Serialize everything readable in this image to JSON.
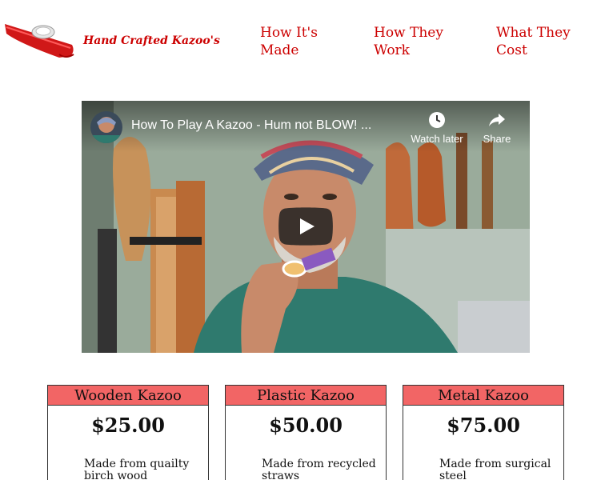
{
  "header": {
    "logo_text": "Hand Crafted Kazoo's",
    "nav": [
      {
        "label": "How It's Made"
      },
      {
        "label": "How They Work"
      },
      {
        "label": "What They Cost"
      }
    ]
  },
  "video": {
    "title": "How To Play A Kazoo - Hum not BLOW! ...",
    "watch_later_label": "Watch later",
    "share_label": "Share"
  },
  "pricing": [
    {
      "name": "Wooden Kazoo",
      "price": "$25.00",
      "description": "Made from quailty birch wood"
    },
    {
      "name": "Plastic Kazoo",
      "price": "$50.00",
      "description": "Made from recycled straws"
    },
    {
      "name": "Metal Kazoo",
      "price": "$75.00",
      "description": "Made from surgical steel"
    }
  ],
  "colors": {
    "brand_red": "#cc0000",
    "card_header": "#f26565"
  }
}
